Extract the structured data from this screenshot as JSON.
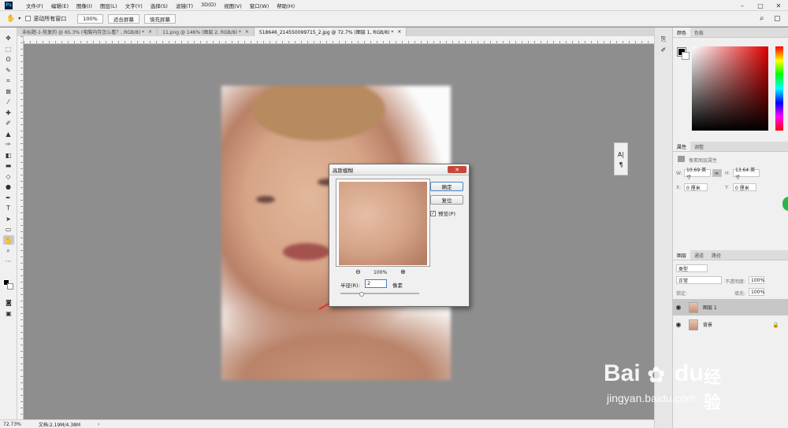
{
  "app": {
    "logo": "Ps"
  },
  "menubar": {
    "items": [
      "文件(F)",
      "编辑(E)",
      "图像(I)",
      "图层(L)",
      "文字(Y)",
      "选择(S)",
      "滤镜(T)",
      "3D(D)",
      "视图(V)",
      "窗口(W)",
      "帮助(H)"
    ],
    "window_controls": [
      "–",
      "□",
      "✕"
    ]
  },
  "options_bar": {
    "scroll_all_label": "滚动所有窗口",
    "zoom_value": "100%",
    "fit_screen": "适合屏幕",
    "fill_screen": "填充屏幕"
  },
  "document_tabs": [
    {
      "label": "未标题-1-恢复的 @ 65.3% (电脑内存怎么看？, RGB/8) *",
      "close": "×",
      "active": false
    },
    {
      "label": "11.png @ 146% (图层 2, RGB/8) *",
      "close": "×",
      "active": false
    },
    {
      "label": "518646_214550099715_2.jpg @ 72.7% (图层 1, RGB/8) *",
      "close": "×",
      "active": true
    }
  ],
  "tools": [
    {
      "icon": "move-icon",
      "glyph": "✥"
    },
    {
      "icon": "marquee-icon",
      "glyph": "⬚"
    },
    {
      "icon": "lasso-icon",
      "glyph": "ʘ"
    },
    {
      "icon": "quick-select-icon",
      "glyph": "✎"
    },
    {
      "icon": "crop-icon",
      "glyph": "⌗"
    },
    {
      "icon": "frame-icon",
      "glyph": "⊠"
    },
    {
      "icon": "eyedropper-icon",
      "glyph": "⁄"
    },
    {
      "icon": "healing-icon",
      "glyph": "✚"
    },
    {
      "icon": "brush-icon",
      "glyph": "✐"
    },
    {
      "icon": "stamp-icon",
      "glyph": "▲"
    },
    {
      "icon": "history-brush-icon",
      "glyph": "✑"
    },
    {
      "icon": "eraser-icon",
      "glyph": "◧"
    },
    {
      "icon": "gradient-icon",
      "glyph": "▬"
    },
    {
      "icon": "blur-icon",
      "glyph": "◇"
    },
    {
      "icon": "dodge-icon",
      "glyph": "●"
    },
    {
      "icon": "pen-icon",
      "glyph": "✒"
    },
    {
      "icon": "type-icon",
      "glyph": "T"
    },
    {
      "icon": "path-select-icon",
      "glyph": "➤"
    },
    {
      "icon": "rectangle-icon",
      "glyph": "▭"
    },
    {
      "icon": "hand-icon",
      "glyph": "✋"
    },
    {
      "icon": "zoom-icon",
      "glyph": "⌕"
    },
    {
      "icon": "more-icon",
      "glyph": "···"
    }
  ],
  "status_bar": {
    "zoom": "72.73%",
    "doc_size": "文档:2.19M/4.38M",
    "arrow": "›"
  },
  "color_panel": {
    "tabs": [
      "颜色",
      "色板"
    ]
  },
  "properties_panel": {
    "tabs": [
      "属性",
      "调整"
    ],
    "heading": "像素图层属性",
    "w_label": "W:",
    "w_value": "10.69 英寸",
    "h_label": "H:",
    "h_value": "13.64 英寸",
    "x_label": "X:",
    "x_value": "0 厘米",
    "y_label": "Y:",
    "y_value": "0 厘米",
    "link_icon": "∞"
  },
  "layers_panel": {
    "tabs": [
      "图层",
      "通道",
      "路径"
    ],
    "filter_kind": "类型",
    "blend_mode": "正常",
    "opacity_label": "不透明度:",
    "opacity_value": "100%",
    "lock_label": "锁定:",
    "fill_label": "填充:",
    "fill_value": "100%",
    "layers": [
      {
        "name": "图层 1",
        "selected": true
      },
      {
        "name": "背景",
        "selected": false,
        "locked": true
      }
    ]
  },
  "dialog": {
    "title": "高斯模糊",
    "close": "✕",
    "ok": "确定",
    "reset": "复位",
    "preview_label": "预览(P)",
    "preview_checked": true,
    "zoom_out": "⊖",
    "zoom_in": "⊕",
    "zoom_level": "100%",
    "radius_label": "半径(R):",
    "radius_value": "2",
    "radius_unit": "像素"
  },
  "watermark": {
    "brand": "Bai",
    "brand2": "du",
    "cn": "经验",
    "url": "jingyan.baidu.com"
  },
  "mini_panel": {
    "items": [
      "A|",
      "¶"
    ]
  },
  "colors": {
    "accent_red": "#e3312f",
    "dialog_close": "#c8463a",
    "ps_blue": "#31a8ff"
  }
}
